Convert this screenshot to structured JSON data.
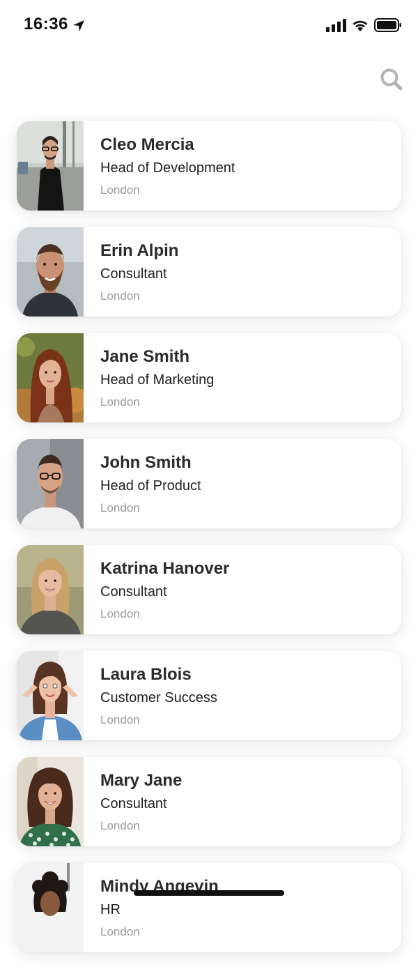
{
  "status_bar": {
    "time": "16:36",
    "icons": [
      "location-arrow-icon",
      "cellular-signal-icon",
      "wifi-icon",
      "battery-icon"
    ]
  },
  "header": {
    "search_icon": "search-icon"
  },
  "contacts": [
    {
      "name": "Cleo Mercia",
      "role": "Head of Development",
      "location": "London"
    },
    {
      "name": "Erin Alpin",
      "role": "Consultant",
      "location": "London"
    },
    {
      "name": "Jane Smith",
      "role": "Head of Marketing",
      "location": "London"
    },
    {
      "name": "John Smith",
      "role": "Head of Product",
      "location": "London"
    },
    {
      "name": "Katrina Hanover",
      "role": "Consultant",
      "location": "London"
    },
    {
      "name": "Laura Blois",
      "role": "Customer Success",
      "location": "London"
    },
    {
      "name": "Mary Jane",
      "role": "Consultant",
      "location": "London"
    },
    {
      "name": "Mindy Angevin",
      "role": "HR",
      "location": "London"
    }
  ],
  "colors": {
    "background": "#ffffff",
    "name_text": "#2b2b2b",
    "role_text": "#1f1f1f",
    "location_text": "#9a9a9a",
    "icon_gray": "#b3b3b3"
  }
}
